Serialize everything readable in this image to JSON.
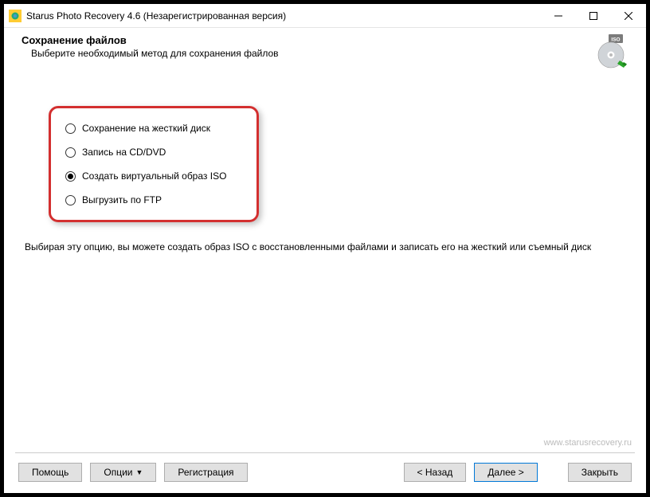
{
  "titlebar": {
    "title": "Starus Photo Recovery 4.6 (Незарегистрированная версия)"
  },
  "header": {
    "title": "Сохранение файлов",
    "subtitle": "Выберите необходимый метод для сохранения файлов"
  },
  "options": {
    "items": [
      {
        "label": "Сохранение на жесткий диск",
        "selected": false
      },
      {
        "label": "Запись на CD/DVD",
        "selected": false
      },
      {
        "label": "Создать виртуальный образ ISO",
        "selected": true
      },
      {
        "label": "Выгрузить по FTP",
        "selected": false
      }
    ]
  },
  "description": "Выбирая эту опцию, вы можете создать образ ISO с восстановленными файлами и записать его на жесткий или съемный диск",
  "watermark": "www.starusrecovery.ru",
  "buttons": {
    "help": "Помощь",
    "options": "Опции",
    "register": "Регистрация",
    "back": "< Назад",
    "next": "Далее >",
    "close": "Закрыть"
  }
}
